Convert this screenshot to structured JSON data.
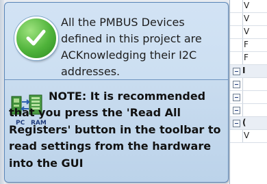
{
  "balloon": {
    "message": "All the PMBUS Devices defined in this project are ACKnowledging their I2C addresses.",
    "note_lead": "NOTE: It is recommended",
    "note_rest": "that you press the 'Read All Registers' button in the toolbar to read settings from the hardware into the GUI",
    "icon_pc": "PC",
    "icon_ram": "RAM",
    "check_icon": "check-circle-icon",
    "transfer_icon": "pc-ram-transfer-icon"
  },
  "grid": {
    "rows": [
      {
        "type": "cell",
        "text": "V"
      },
      {
        "type": "cell",
        "text": "V"
      },
      {
        "type": "cell",
        "text": "V"
      },
      {
        "type": "cell",
        "text": "F"
      },
      {
        "type": "cell",
        "text": "F"
      },
      {
        "type": "section",
        "text": "I"
      },
      {
        "type": "expand",
        "text": ""
      },
      {
        "type": "expand",
        "text": ""
      },
      {
        "type": "expand",
        "text": ""
      },
      {
        "type": "section",
        "text": "("
      },
      {
        "type": "cell",
        "text": "V"
      }
    ]
  },
  "colors": {
    "balloon_border": "#5a86b8",
    "check_green": "#4fb33a"
  }
}
